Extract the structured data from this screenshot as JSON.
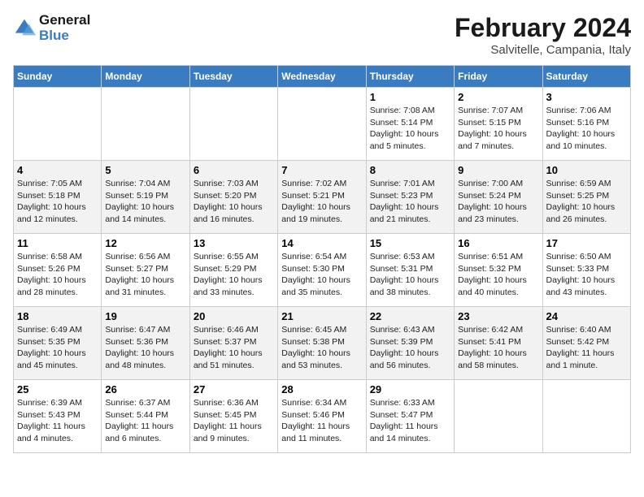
{
  "logo": {
    "line1": "General",
    "line2": "Blue"
  },
  "title": "February 2024",
  "subtitle": "Salvitelle, Campania, Italy",
  "headers": [
    "Sunday",
    "Monday",
    "Tuesday",
    "Wednesday",
    "Thursday",
    "Friday",
    "Saturday"
  ],
  "weeks": [
    [
      {
        "day": "",
        "info": ""
      },
      {
        "day": "",
        "info": ""
      },
      {
        "day": "",
        "info": ""
      },
      {
        "day": "",
        "info": ""
      },
      {
        "day": "1",
        "info": "Sunrise: 7:08 AM\nSunset: 5:14 PM\nDaylight: 10 hours\nand 5 minutes."
      },
      {
        "day": "2",
        "info": "Sunrise: 7:07 AM\nSunset: 5:15 PM\nDaylight: 10 hours\nand 7 minutes."
      },
      {
        "day": "3",
        "info": "Sunrise: 7:06 AM\nSunset: 5:16 PM\nDaylight: 10 hours\nand 10 minutes."
      }
    ],
    [
      {
        "day": "4",
        "info": "Sunrise: 7:05 AM\nSunset: 5:18 PM\nDaylight: 10 hours\nand 12 minutes."
      },
      {
        "day": "5",
        "info": "Sunrise: 7:04 AM\nSunset: 5:19 PM\nDaylight: 10 hours\nand 14 minutes."
      },
      {
        "day": "6",
        "info": "Sunrise: 7:03 AM\nSunset: 5:20 PM\nDaylight: 10 hours\nand 16 minutes."
      },
      {
        "day": "7",
        "info": "Sunrise: 7:02 AM\nSunset: 5:21 PM\nDaylight: 10 hours\nand 19 minutes."
      },
      {
        "day": "8",
        "info": "Sunrise: 7:01 AM\nSunset: 5:23 PM\nDaylight: 10 hours\nand 21 minutes."
      },
      {
        "day": "9",
        "info": "Sunrise: 7:00 AM\nSunset: 5:24 PM\nDaylight: 10 hours\nand 23 minutes."
      },
      {
        "day": "10",
        "info": "Sunrise: 6:59 AM\nSunset: 5:25 PM\nDaylight: 10 hours\nand 26 minutes."
      }
    ],
    [
      {
        "day": "11",
        "info": "Sunrise: 6:58 AM\nSunset: 5:26 PM\nDaylight: 10 hours\nand 28 minutes."
      },
      {
        "day": "12",
        "info": "Sunrise: 6:56 AM\nSunset: 5:27 PM\nDaylight: 10 hours\nand 31 minutes."
      },
      {
        "day": "13",
        "info": "Sunrise: 6:55 AM\nSunset: 5:29 PM\nDaylight: 10 hours\nand 33 minutes."
      },
      {
        "day": "14",
        "info": "Sunrise: 6:54 AM\nSunset: 5:30 PM\nDaylight: 10 hours\nand 35 minutes."
      },
      {
        "day": "15",
        "info": "Sunrise: 6:53 AM\nSunset: 5:31 PM\nDaylight: 10 hours\nand 38 minutes."
      },
      {
        "day": "16",
        "info": "Sunrise: 6:51 AM\nSunset: 5:32 PM\nDaylight: 10 hours\nand 40 minutes."
      },
      {
        "day": "17",
        "info": "Sunrise: 6:50 AM\nSunset: 5:33 PM\nDaylight: 10 hours\nand 43 minutes."
      }
    ],
    [
      {
        "day": "18",
        "info": "Sunrise: 6:49 AM\nSunset: 5:35 PM\nDaylight: 10 hours\nand 45 minutes."
      },
      {
        "day": "19",
        "info": "Sunrise: 6:47 AM\nSunset: 5:36 PM\nDaylight: 10 hours\nand 48 minutes."
      },
      {
        "day": "20",
        "info": "Sunrise: 6:46 AM\nSunset: 5:37 PM\nDaylight: 10 hours\nand 51 minutes."
      },
      {
        "day": "21",
        "info": "Sunrise: 6:45 AM\nSunset: 5:38 PM\nDaylight: 10 hours\nand 53 minutes."
      },
      {
        "day": "22",
        "info": "Sunrise: 6:43 AM\nSunset: 5:39 PM\nDaylight: 10 hours\nand 56 minutes."
      },
      {
        "day": "23",
        "info": "Sunrise: 6:42 AM\nSunset: 5:41 PM\nDaylight: 10 hours\nand 58 minutes."
      },
      {
        "day": "24",
        "info": "Sunrise: 6:40 AM\nSunset: 5:42 PM\nDaylight: 11 hours\nand 1 minute."
      }
    ],
    [
      {
        "day": "25",
        "info": "Sunrise: 6:39 AM\nSunset: 5:43 PM\nDaylight: 11 hours\nand 4 minutes."
      },
      {
        "day": "26",
        "info": "Sunrise: 6:37 AM\nSunset: 5:44 PM\nDaylight: 11 hours\nand 6 minutes."
      },
      {
        "day": "27",
        "info": "Sunrise: 6:36 AM\nSunset: 5:45 PM\nDaylight: 11 hours\nand 9 minutes."
      },
      {
        "day": "28",
        "info": "Sunrise: 6:34 AM\nSunset: 5:46 PM\nDaylight: 11 hours\nand 11 minutes."
      },
      {
        "day": "29",
        "info": "Sunrise: 6:33 AM\nSunset: 5:47 PM\nDaylight: 11 hours\nand 14 minutes."
      },
      {
        "day": "",
        "info": ""
      },
      {
        "day": "",
        "info": ""
      }
    ]
  ]
}
